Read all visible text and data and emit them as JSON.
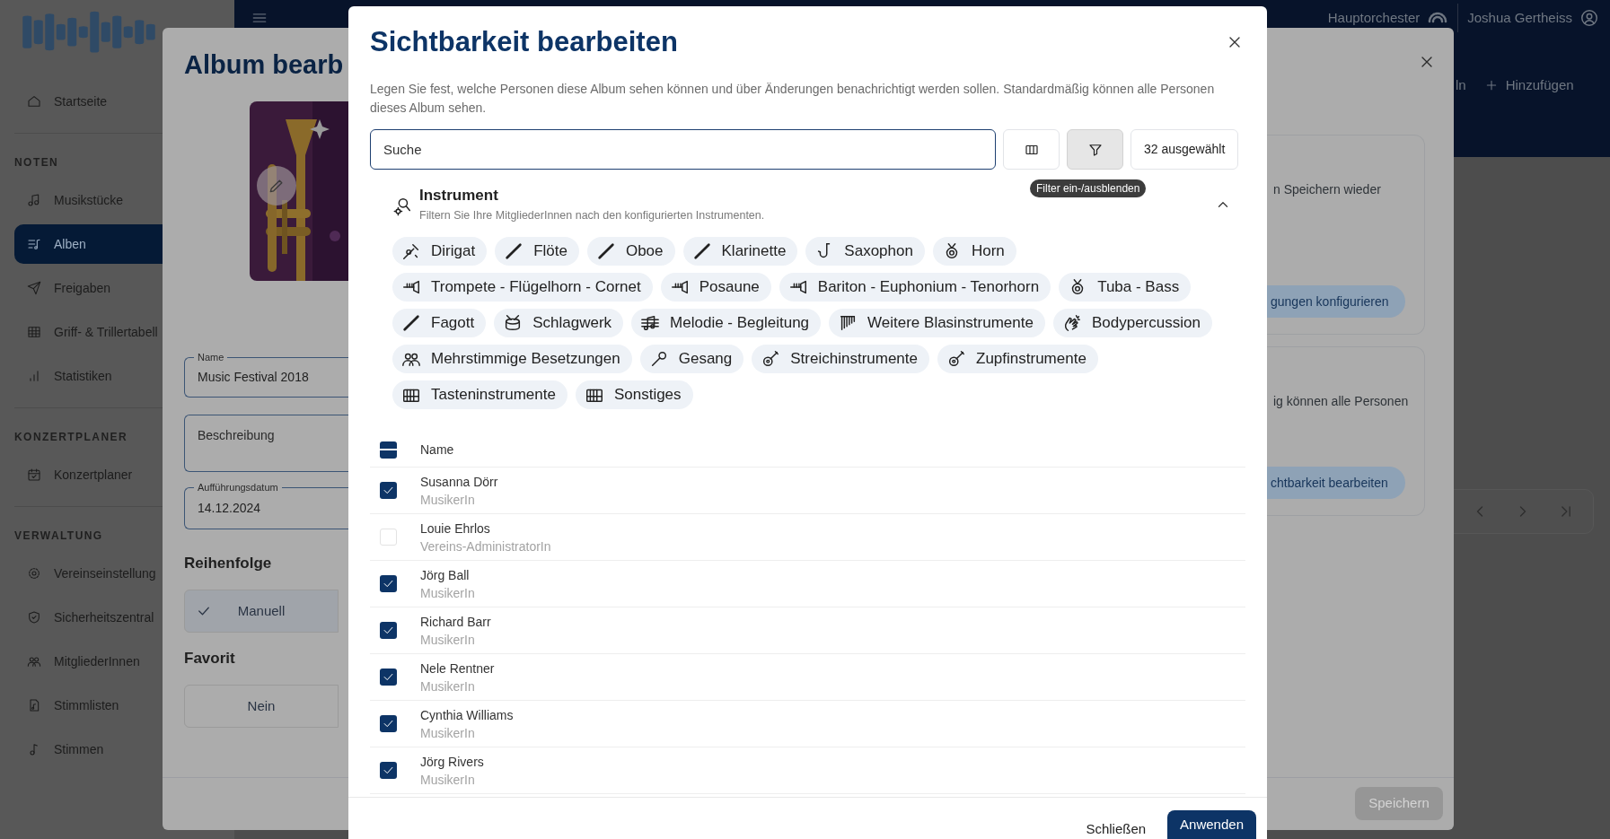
{
  "top_bar": {
    "org": "Hauptorchester",
    "user": "Joshua Gertheiss",
    "actions": [
      {
        "label": "ln",
        "kind": "text"
      },
      {
        "label": "Hinzufügen",
        "kind": "add"
      }
    ]
  },
  "sidebar": {
    "sections": [
      {
        "items": [
          {
            "label": "Startseite",
            "selected": false
          }
        ]
      },
      {
        "heading": "NOTEN",
        "items": [
          {
            "label": "Musikstücke",
            "selected": false
          },
          {
            "label": "Alben",
            "selected": true
          },
          {
            "label": "Freigaben",
            "selected": false
          },
          {
            "label": "Griff- & Trillertabell",
            "selected": false
          },
          {
            "label": "Statistiken",
            "selected": false
          }
        ]
      },
      {
        "heading": "KONZERTPLANER",
        "items": [
          {
            "label": "Konzertplaner",
            "selected": false
          }
        ]
      },
      {
        "heading": "VERWALTUNG",
        "items": [
          {
            "label": "Vereinseinstellung",
            "selected": false
          },
          {
            "label": "Sicherheitszentral",
            "selected": false
          },
          {
            "label": "MitgliederInnen",
            "selected": false
          },
          {
            "label": "Stimmlisten",
            "selected": false
          },
          {
            "label": "Stimmen",
            "selected": false
          }
        ]
      }
    ]
  },
  "album_dialog": {
    "title": "Album bearb",
    "fields": [
      {
        "label": "Name",
        "value": "Music Festival 2018"
      },
      {
        "placeholder": "Beschreibung"
      },
      {
        "label": "Aufführungsdatum",
        "value": "14.12.2024"
      }
    ],
    "order": {
      "heading": "Reihenfolge",
      "option": {
        "label": "Manuell",
        "selected": true
      }
    },
    "favorite": {
      "heading": "Favorit",
      "option": {
        "label": "Nein",
        "selected": false
      }
    },
    "cards": [
      {
        "text": "n Speichern wieder",
        "button": "gungen konfigurieren"
      },
      {
        "text": "ig können alle Personen",
        "button": "chtbarkeit bearbeiten"
      }
    ],
    "save_button": {
      "label": "Speichern",
      "disabled": true
    }
  },
  "visibility_dialog": {
    "title": "Sichtbarkeit bearbeiten",
    "description": "Legen Sie fest, welche Personen diese Album sehen können und über Änderungen benachrichtigt werden sollen. Standardmäßig können alle Personen dieses Album sehen.",
    "search": {
      "placeholder": "Suche"
    },
    "filter_active": true,
    "filter_tooltip": "Filter ein-/ausblenden",
    "selected_count": "32 ausgewählt",
    "filter_section": {
      "title": "Instrument",
      "subtitle": "Filtern Sie Ihre MitgliederInnen nach den konfigurierten Instrumenten.",
      "expanded": true,
      "chip_rows": [
        [
          "Dirigat",
          "Flöte",
          "Oboe",
          "Klarinette",
          "Saxophon",
          "Horn"
        ],
        [
          "Trompete - Flügelhorn - Cornet",
          "Posaune",
          "Bariton - Euphonium - Tenorhorn",
          "Tuba - Bass"
        ],
        [
          "Fagott",
          "Schlagwerk",
          "Melodie - Begleitung",
          "Weitere Blasinstrumente",
          "Bodypercussion"
        ],
        [
          "Mehrstimmige Besetzungen",
          "Gesang",
          "Streichinstrumente",
          "Zupfinstrumente"
        ],
        [
          "Tasteninstrumente",
          "Sonstiges"
        ]
      ]
    },
    "table": {
      "header_partial": true,
      "column": "Name",
      "rows": [
        {
          "name": "Susanna Dörr",
          "role": "MusikerIn",
          "checked": true
        },
        {
          "name": "Louie Ehrlos",
          "role": "Vereins-AdministratorIn",
          "checked": false
        },
        {
          "name": "Jörg Ball",
          "role": "MusikerIn",
          "checked": true
        },
        {
          "name": "Richard Barr",
          "role": "MusikerIn",
          "checked": true
        },
        {
          "name": "Nele Rentner",
          "role": "MusikerIn",
          "checked": true
        },
        {
          "name": "Cynthia Williams",
          "role": "MusikerIn",
          "checked": true
        },
        {
          "name": "Jörg Rivers",
          "role": "MusikerIn",
          "checked": true
        }
      ]
    },
    "buttons": {
      "close": "Schließen",
      "apply": "Anwenden"
    }
  }
}
